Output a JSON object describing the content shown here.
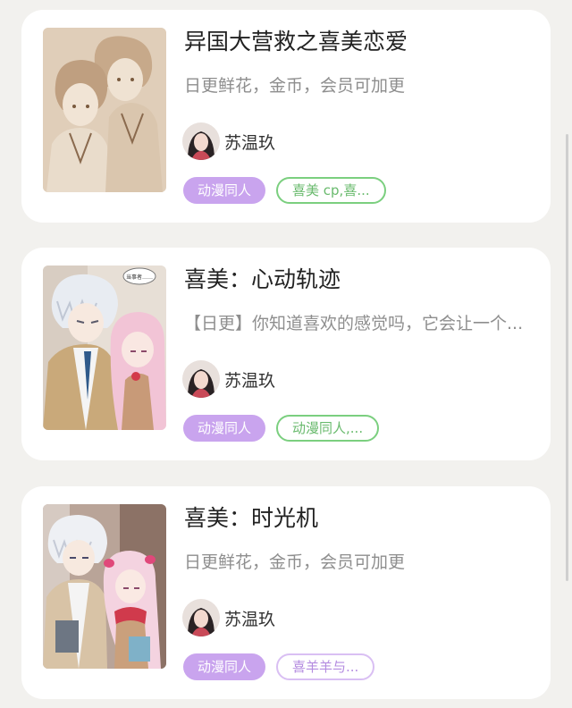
{
  "items": [
    {
      "title": "异国大营救之喜美恋爱",
      "description": "日更鲜花，金币，会员可加更",
      "author": "苏温玖",
      "tag_primary": "动漫同人",
      "tag_secondary": "喜美 cp,喜...",
      "tag_secondary_color": "#7bcf7f"
    },
    {
      "title": "喜美：心动轨迹",
      "description": "【日更】你知道喜欢的感觉吗，它会让一个...",
      "author": "苏温玖",
      "tag_primary": "动漫同人",
      "tag_secondary": "动漫同人,...",
      "tag_secondary_color": "#7bcf7f",
      "cover_speech_text": "当事者……"
    },
    {
      "title": "喜美：时光机",
      "description": "日更鲜花，金币，会员可加更",
      "author": "苏温玖",
      "tag_primary": "动漫同人",
      "tag_secondary": "喜羊羊与...",
      "tag_secondary_color": "#d9bff3"
    }
  ],
  "colors": {
    "background": "#f2f1ee",
    "card": "#ffffff",
    "tag_fill": "#c9a4ee"
  }
}
